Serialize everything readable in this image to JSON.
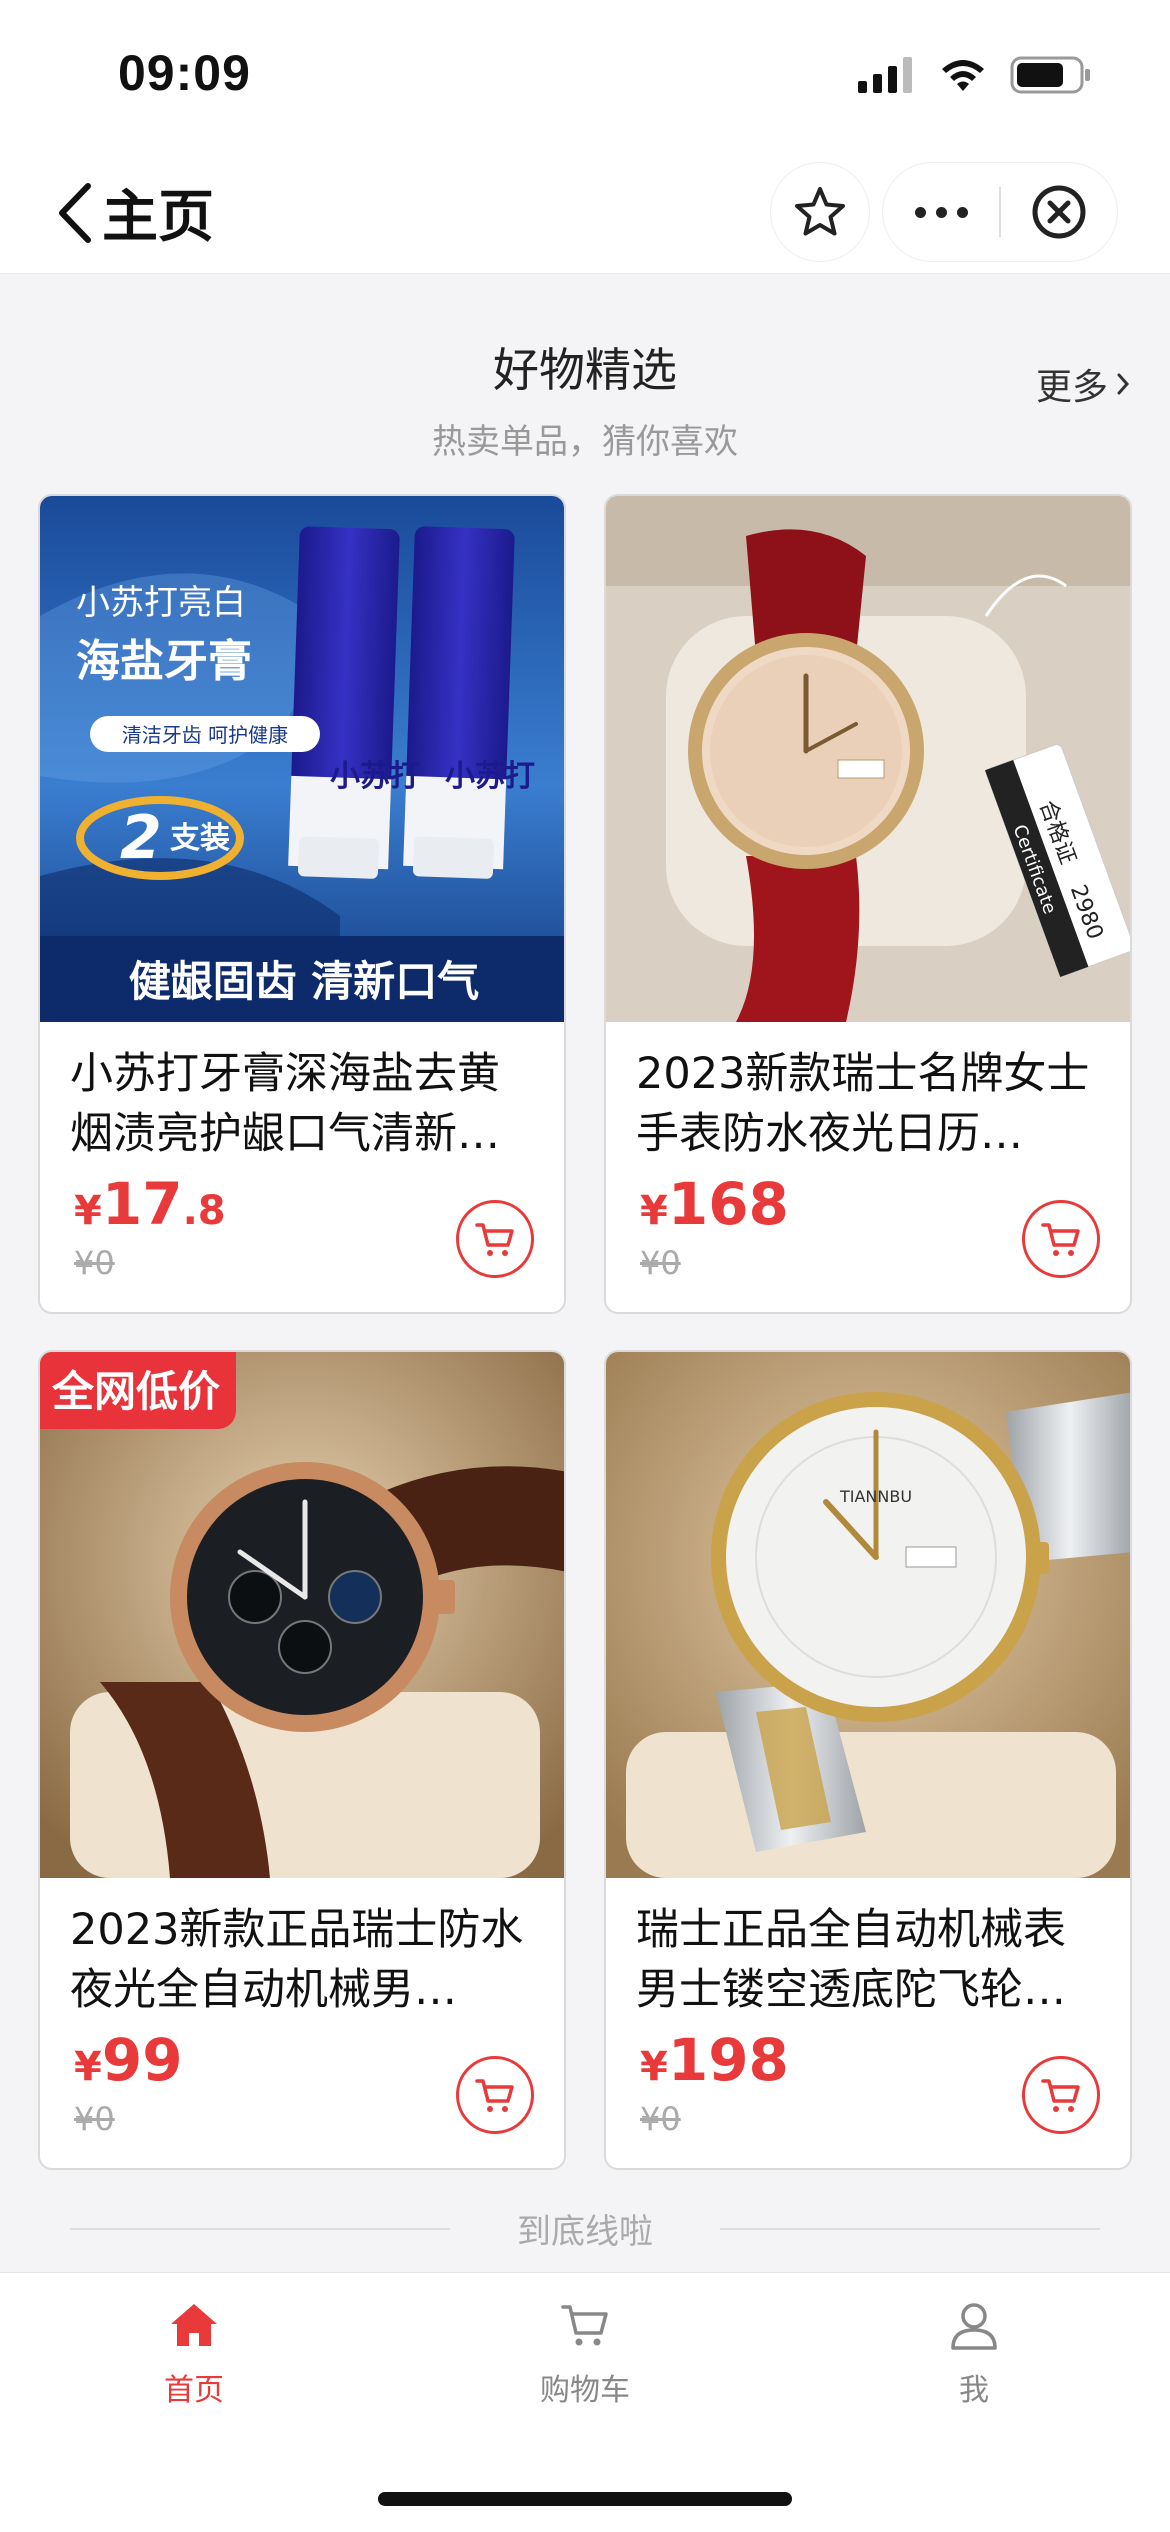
{
  "status_bar": {
    "time": "09:09"
  },
  "nav": {
    "title": "主页"
  },
  "section": {
    "title": "好物精选",
    "subtitle": "热卖单品，猜你喜欢",
    "more": "更多"
  },
  "products": [
    {
      "name": "小苏打牙膏深海盐去黄烟渍亮护龈口气清新…",
      "price_int": "17",
      "price_dec": ".8",
      "currency": "¥",
      "old_price": "¥0",
      "image": {
        "line1": "小苏打亮白",
        "line2": "海盐牙膏",
        "tag": "清洁牙齿 呵护健康",
        "count_num": "2",
        "count_label": "支装",
        "tube_text": "小苏打",
        "bottom": "健龈固齿 清新口气"
      }
    },
    {
      "name": "2023新款瑞士名牌女士手表防水夜光日历…",
      "price_int": "168",
      "price_dec": "",
      "currency": "¥",
      "old_price": "¥0",
      "image": {
        "tag_lines": [
          "Certificate",
          "合格证",
          "2980"
        ]
      }
    },
    {
      "name": "2023新款正品瑞士防水夜光全自动机械男…",
      "price_int": "99",
      "price_dec": "",
      "currency": "¥",
      "old_price": "¥0",
      "badge": "全网低价"
    },
    {
      "name": "瑞士正品全自动机械表男士镂空透底陀飞轮…",
      "price_int": "198",
      "price_dec": "",
      "currency": "¥",
      "old_price": "¥0",
      "image": {
        "brand": "TIANNBU"
      }
    }
  ],
  "end_text": "到底线啦",
  "tabs": [
    {
      "label": "首页",
      "icon": "home-icon",
      "active": true
    },
    {
      "label": "购物车",
      "icon": "cart-icon",
      "active": false
    },
    {
      "label": "我",
      "icon": "user-icon",
      "active": false
    }
  ],
  "colors": {
    "accent": "#e83a3a",
    "badge": "#e8333a",
    "background": "#f4f4f6"
  }
}
